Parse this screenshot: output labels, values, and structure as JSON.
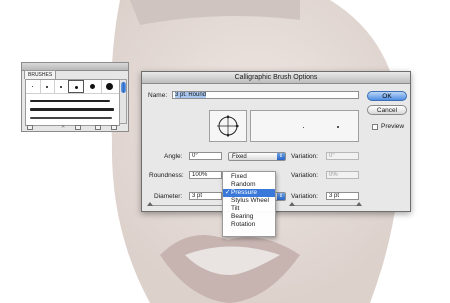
{
  "brushes_panel": {
    "tab_label": "BRUSHES"
  },
  "dialog": {
    "title": "Calligraphic Brush Options",
    "name_label": "Name:",
    "name_value": "3 pt. Round",
    "ok_label": "OK",
    "cancel_label": "Cancel",
    "preview_label": "Preview",
    "angle": {
      "label": "Angle:",
      "value": "0°",
      "mode": "Fixed",
      "variation_label": "Variation:",
      "variation_value": "0°"
    },
    "roundness": {
      "label": "Roundness:",
      "value": "100%",
      "variation_label": "Variation:",
      "variation_value": "0%"
    },
    "diameter": {
      "label": "Diameter:",
      "value": "3 pt",
      "variation_label": "Variation:",
      "variation_value": "3 pt"
    }
  },
  "menu": {
    "items": [
      "Fixed",
      "Random",
      "Pressure",
      "Stylus Wheel",
      "Tilt",
      "Bearing",
      "Rotation"
    ],
    "selected_index": 2,
    "check_glyph": "✓"
  },
  "colors": {
    "accent": "#3a78d9",
    "default_button": "#4f8ee3"
  }
}
